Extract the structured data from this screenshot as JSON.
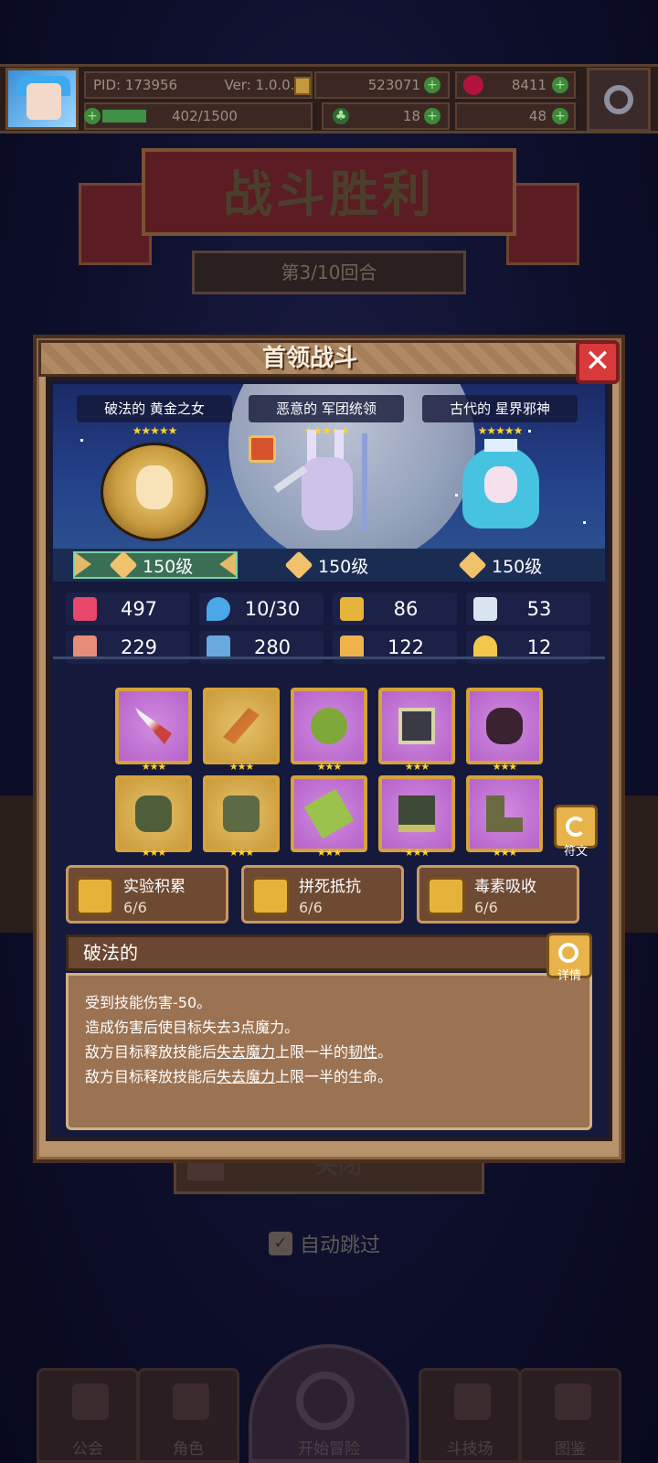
{
  "header": {
    "pid": "PID: 173956",
    "version": "Ver: 1.0.0.9",
    "gold": "523071",
    "gems": "8411",
    "stamina": "402/1500",
    "clover": "18",
    "keys": "48"
  },
  "battle": {
    "result_title": "战斗胜利",
    "round": "第3/10回合",
    "close_label": "关闭",
    "auto_skip": "自动跳过"
  },
  "bottom_nav": [
    {
      "label": "公会"
    },
    {
      "label": "角色"
    },
    {
      "label": "开始冒险"
    },
    {
      "label": "斗技场"
    },
    {
      "label": "图鉴"
    }
  ],
  "modal": {
    "title": "首领战斗",
    "close_symbol": "✕",
    "bosses": [
      {
        "name": "破法的 黄金之女",
        "stars": "★★★★★",
        "level": "150级"
      },
      {
        "name": "恶意的 军团统领",
        "stars": "★★★★★",
        "level": "150级"
      },
      {
        "name": "古代的 星界邪神",
        "stars": "★★★★★",
        "level": "150级"
      }
    ],
    "stats": [
      {
        "icon": "heart-icon",
        "value": "497",
        "color": "#e8466a"
      },
      {
        "icon": "water-drop-icon",
        "value": "10/30",
        "color": "#4aa7e8"
      },
      {
        "icon": "shield-icon",
        "value": "86",
        "color": "#e6b43a"
      },
      {
        "icon": "wing-icon",
        "value": "53",
        "color": "#d8e4f0"
      },
      {
        "icon": "fist-icon",
        "value": "229",
        "color": "#e88c7a"
      },
      {
        "icon": "book-icon",
        "value": "280",
        "color": "#6aa9e0"
      },
      {
        "icon": "potion-icon",
        "value": "122",
        "color": "#f0b24a"
      },
      {
        "icon": "horseshoe-icon",
        "value": "12",
        "color": "#f2c84a"
      }
    ],
    "equip_stars": "★★★",
    "rune_label": "符文",
    "skills": [
      {
        "name": "实验积累",
        "count": "6/6"
      },
      {
        "name": "拼死抵抗",
        "count": "6/6"
      },
      {
        "name": "毒素吸收",
        "count": "6/6"
      }
    ],
    "trait": {
      "title": "破法的",
      "detail_label": "详情",
      "lines": [
        "受到技能伤害-50。",
        "造成伤害后使目标失去3点魔力。"
      ],
      "line3_pre": "敌方目标释放技能后",
      "line3_u1": "失去魔力",
      "line3_mid": "上限一半的",
      "line3_u2": "韧性",
      "line3_end": "。",
      "line4_pre": "敌方目标释放技能后",
      "line4_u1": "失去魔力",
      "line4_end": "上限一半的生命。"
    }
  }
}
